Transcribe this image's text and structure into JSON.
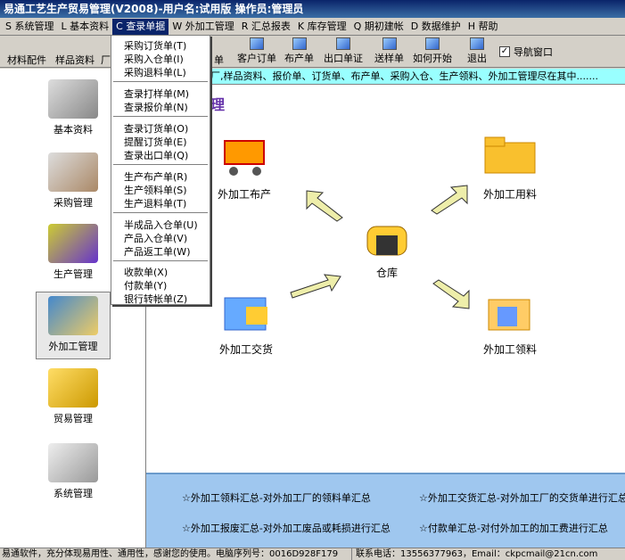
{
  "window": {
    "title": "易通工艺生产贸易管理(V2008)-用户名:试用版 操作员:管理员"
  },
  "menu": [
    {
      "key": "S",
      "label": "系统管理"
    },
    {
      "key": "L",
      "label": "基本资料"
    },
    {
      "key": "C",
      "label": "查录单据"
    },
    {
      "key": "W",
      "label": "外加工管理"
    },
    {
      "key": "R",
      "label": "汇总报表"
    },
    {
      "key": "K",
      "label": "库存管理"
    },
    {
      "key": "Q",
      "label": "期初建帐"
    },
    {
      "key": "D",
      "label": "数据维护"
    },
    {
      "key": "H",
      "label": "帮助"
    }
  ],
  "toolbar": {
    "buttons": [
      "材料配件",
      "样品资料",
      "厂",
      "单",
      "客户订单",
      "布产单",
      "出口单证",
      "送样单",
      "如何开始",
      "退出"
    ],
    "nav_window_label": "导航窗口"
  },
  "dropdown": [
    {
      "label": "采购订货单",
      "key": "T"
    },
    {
      "label": "采购入仓单",
      "key": "I"
    },
    {
      "label": "采购退料单",
      "key": "L"
    },
    {
      "label": "查录打样单",
      "key": "M"
    },
    {
      "label": "查录报价单",
      "key": "N"
    },
    {
      "label": "查录订货单",
      "key": "O"
    },
    {
      "label": "提醒订货单",
      "key": "E"
    },
    {
      "label": "查录出口单",
      "key": "Q"
    },
    {
      "label": "生产布产单",
      "key": "R"
    },
    {
      "label": "生产领料单",
      "key": "S"
    },
    {
      "label": "生产退料单",
      "key": "T"
    },
    {
      "label": "半成品入仓单",
      "key": "U"
    },
    {
      "label": "产品入仓单",
      "key": "V"
    },
    {
      "label": "产品返工单",
      "key": "W"
    },
    {
      "label": "收款单",
      "key": "X"
    },
    {
      "label": "付款单",
      "key": "Y"
    },
    {
      "label": "银行转帐单",
      "key": "Z"
    }
  ],
  "sidebar": [
    "基本资料",
    "采购管理",
    "生产管理",
    "外加工管理",
    "贸易管理",
    "系统管理"
  ],
  "marquee": "厂,样品资料、报价单、订货单、布产单、采购入仓、生产领料、外加工管理尽在其中.......",
  "heading": "管理",
  "flow": {
    "top_left": "外加工布产",
    "top_right": "外加工用料",
    "center": "仓库",
    "bottom_left": "外加工交货",
    "bottom_right": "外加工领料"
  },
  "summaries": [
    "☆外加工领料汇总-对外加工厂的领料单汇总",
    "☆外加工交货汇总-对外加工厂的交货单进行汇总",
    "☆外加工报废汇总-对外加工废品或耗损进行汇总",
    "☆付款单汇总-对付外加工的加工费进行汇总"
  ],
  "status": {
    "left": "易通软件，充分体现易用性、通用性，感谢您的使用。电脑序列号：0016D928F179",
    "right": "联系电话：13556377963，Email：ckpcmail@21cn.com"
  },
  "colors": {
    "title_bar": "#0a246a",
    "marquee_bg": "#99ffff",
    "bottom_bg": "#9fc7ef",
    "heading": "#6633aa",
    "arrow": "#eeeeaa"
  }
}
